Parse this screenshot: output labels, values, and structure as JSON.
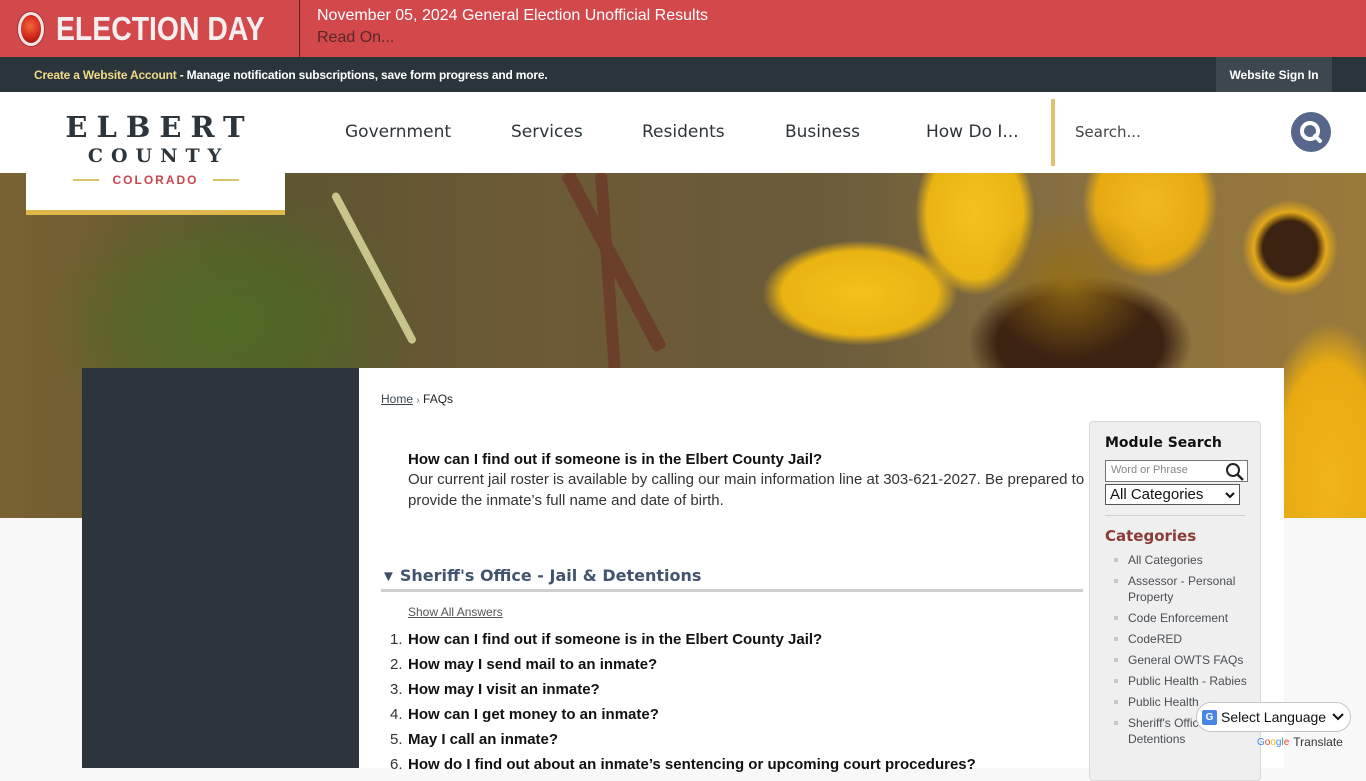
{
  "alert": {
    "title": "ELECTION DAY",
    "headline": "November 05, 2024 General Election Unofficial Results",
    "link": "Read On..."
  },
  "account_bar": {
    "create_link": "Create a Website Account",
    "message": " - Manage notification subscriptions, save form progress and more.",
    "sign_in": "Website Sign In"
  },
  "logo": {
    "line1": "ELBERT",
    "line2": "COUNTY",
    "line3": "COLORADO"
  },
  "nav": {
    "items": [
      "Government",
      "Services",
      "Residents",
      "Business",
      "How Do I..."
    ]
  },
  "search": {
    "placeholder": "Search..."
  },
  "breadcrumb": {
    "home": "Home",
    "separator": "›",
    "current": "FAQs"
  },
  "answer": {
    "question": "How can I find out if someone is in the Elbert County Jail?",
    "text": "Our current jail roster is available by calling our main information line at 303-621-2027. Be prepared to provide the inmate’s full name and date of birth."
  },
  "section": {
    "arrow": "▼",
    "title": "Sheriff's Office - Jail & Detentions",
    "show_all": "Show All Answers"
  },
  "faqs": [
    {
      "num": "1.",
      "q": "How can I find out if someone is in the Elbert County Jail?"
    },
    {
      "num": "2.",
      "q": "How may I send mail to an inmate?"
    },
    {
      "num": "3.",
      "q": "How may I visit an inmate?"
    },
    {
      "num": "4.",
      "q": "How can I get money to an inmate?"
    },
    {
      "num": "5.",
      "q": "May I call an inmate?"
    },
    {
      "num": "6.",
      "q": "How do I find out about an inmate’s sentencing or upcoming court procedures?"
    }
  ],
  "module": {
    "title": "Module Search",
    "input_placeholder": "Word or Phrase",
    "select_value": "All Categories",
    "categories_title": "Categories",
    "categories": [
      "All Categories",
      "Assessor - Personal Property",
      "Code Enforcement",
      "CodeRED",
      "General OWTS FAQs",
      "Public Health - Rabies",
      "Public Health",
      "Sheriff's Office - Jail & Detentions"
    ]
  },
  "translate": {
    "label": "Select Language",
    "powered_brand": "Google",
    "powered_label": "Translate"
  },
  "colors": {
    "alert_red": "#d2484b",
    "account_bar": "#2a343b",
    "gold_accent": "#dfb84b",
    "nav_text": "#2c353b",
    "search_button": "#56678a",
    "section_title": "#43556e",
    "categories_title": "#8b3a36"
  }
}
